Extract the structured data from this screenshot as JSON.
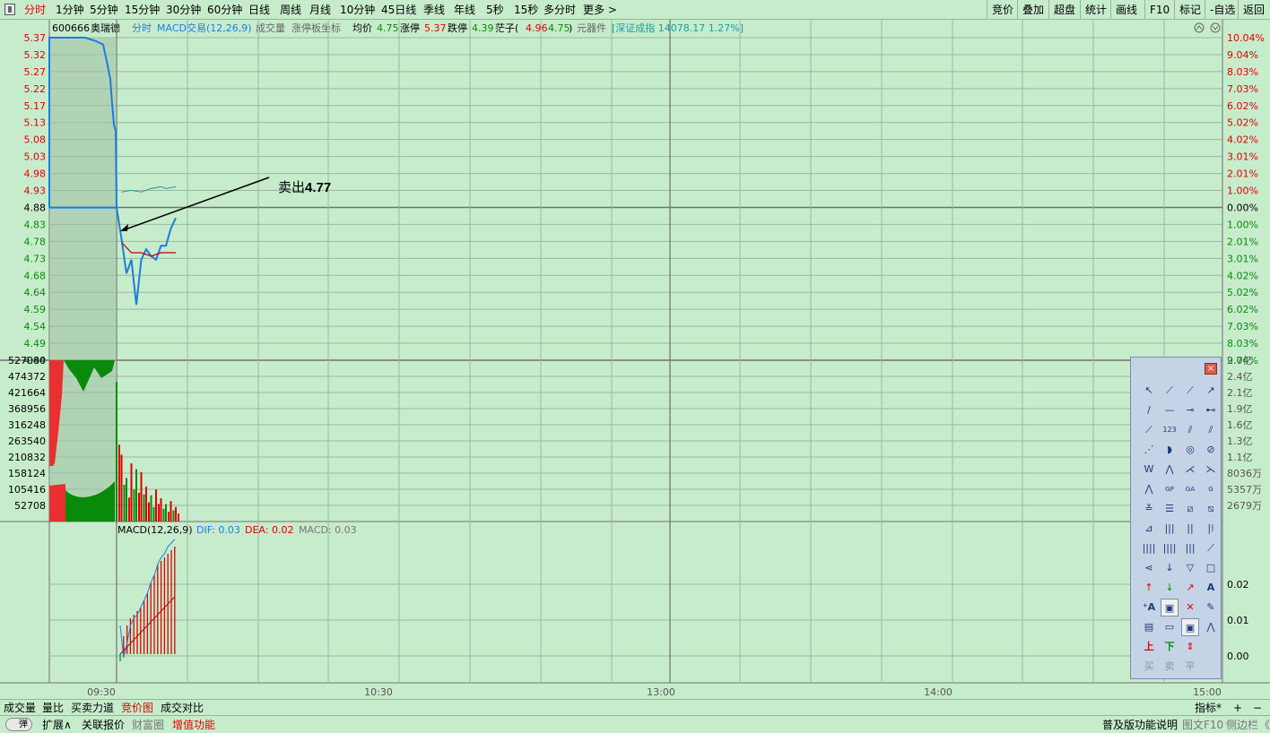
{
  "topbar": {
    "tabs": [
      "分时",
      "1分钟",
      "5分钟",
      "15分钟",
      "30分钟",
      "60分钟",
      "日线",
      "周线",
      "月线",
      "10分钟",
      "45日线",
      "季线",
      "年线",
      "5秒",
      "15秒",
      "多分时",
      "更多 >"
    ],
    "right": [
      "竞价",
      "叠加",
      "超盘",
      "统计",
      "画线",
      "F10",
      "标记",
      "-自选",
      "返回"
    ]
  },
  "header": {
    "code": "600666",
    "name": "奥瑞德",
    "mode": "分时",
    "indicator": "MACD交易(12,26,9)",
    "vol_label": "成交量",
    "limit_label": "涨停板坐标",
    "avg_label": "均价",
    "avg_value": "4.75",
    "up_label": "涨停",
    "up_value": "5.37",
    "down_label": "跌停",
    "down_value": "4.39",
    "bid_label": "茫子(",
    "bid_value1": "4.96",
    "bid_value2": "4.75",
    "bid_close": ")",
    "sector": "元器件",
    "index_text": "[深证成指 14078.17 1.27%]"
  },
  "price_axis": {
    "left": [
      "5.37",
      "5.32",
      "5.27",
      "5.22",
      "5.17",
      "5.13",
      "5.08",
      "5.03",
      "4.98",
      "4.93",
      "4.88",
      "4.83",
      "4.78",
      "4.73",
      "4.68",
      "4.64",
      "4.59",
      "4.54",
      "4.49",
      "4.44"
    ],
    "right": [
      "10.04%",
      "9.04%",
      "8.03%",
      "7.03%",
      "6.02%",
      "5.02%",
      "4.02%",
      "3.01%",
      "2.01%",
      "1.00%",
      "0.00%",
      "1.00%",
      "2.01%",
      "3.01%",
      "4.02%",
      "5.02%",
      "6.02%",
      "7.03%",
      "8.03%",
      "9.04%"
    ]
  },
  "volume_axis": {
    "left": [
      "527080",
      "474372",
      "421664",
      "368956",
      "316248",
      "263540",
      "210832",
      "158124",
      "105416",
      "52708"
    ],
    "right": [
      "2.7亿",
      "2.4亿",
      "2.1亿",
      "1.9亿",
      "1.6亿",
      "1.3亿",
      "1.1亿",
      "8036万",
      "5357万",
      "2679万"
    ]
  },
  "macd": {
    "title": "MACD(12,26,9)",
    "dif_label": "DIF: 0.03",
    "dea_label": "DEA: 0.02",
    "macd_label": "MACD: 0.03",
    "right": [
      "0.02",
      "0.01",
      "0.00"
    ]
  },
  "time_axis": [
    "09:30",
    "10:30",
    "13:00",
    "14:00",
    "15:00"
  ],
  "annotation": {
    "text": "卖出",
    "price": "4.77"
  },
  "bottombar": {
    "tabs": [
      "成交量",
      "量比",
      "买卖力道",
      "竞价图",
      "成交对比"
    ],
    "active": "竞价图",
    "right_label": "指标*",
    "plus": "+",
    "minus": "−"
  },
  "bottombar2": {
    "toggle": "弹",
    "items": [
      "扩展∧",
      "关联报价",
      "财富圈",
      "增值功能"
    ],
    "right": [
      "普及版功能说明",
      "图文F10",
      "侧边栏",
      "《"
    ]
  },
  "toolbox": {
    "close": "×",
    "bottom": [
      "买",
      "卖",
      "平"
    ]
  },
  "colors": {
    "bg": "#c7eccc",
    "up": "#e00000",
    "down": "#0a8a0a",
    "price_line": "#1c7de0",
    "avg_line": "#c00000"
  },
  "chart_data": {
    "type": "line",
    "title": "600666 奥瑞德 分时",
    "price_ylim": [
      4.44,
      5.37
    ],
    "prev_close": 4.88,
    "price_series": [
      {
        "t": "09:30",
        "v": 4.88
      },
      {
        "t": "09:31",
        "v": 4.79
      },
      {
        "t": "09:32",
        "v": 4.69
      },
      {
        "t": "09:33",
        "v": 4.73
      },
      {
        "t": "09:34",
        "v": 4.6
      },
      {
        "t": "09:35",
        "v": 4.73
      },
      {
        "t": "09:36",
        "v": 4.76
      },
      {
        "t": "09:37",
        "v": 4.74
      },
      {
        "t": "09:38",
        "v": 4.73
      },
      {
        "t": "09:39",
        "v": 4.77
      },
      {
        "t": "09:40",
        "v": 4.77
      },
      {
        "t": "09:41",
        "v": 4.82
      },
      {
        "t": "09:42",
        "v": 4.85
      }
    ],
    "avg_series": [
      {
        "t": "09:31",
        "v": 4.78
      },
      {
        "t": "09:33",
        "v": 4.75
      },
      {
        "t": "09:35",
        "v": 4.75
      },
      {
        "t": "09:37",
        "v": 4.74
      },
      {
        "t": "09:39",
        "v": 4.75
      },
      {
        "t": "09:42",
        "v": 4.75
      }
    ],
    "volume": [
      {
        "t": "09:30",
        "v": 480000,
        "dir": "down"
      },
      {
        "t": "09:31",
        "v": 230000,
        "dir": "up"
      },
      {
        "t": "09:32",
        "v": 150000,
        "dir": "down"
      },
      {
        "t": "09:33",
        "v": 200000,
        "dir": "up"
      },
      {
        "t": "09:34",
        "v": 180000,
        "dir": "down"
      },
      {
        "t": "09:35",
        "v": 170000,
        "dir": "up"
      },
      {
        "t": "09:36",
        "v": 120000,
        "dir": "up"
      },
      {
        "t": "09:37",
        "v": 90000,
        "dir": "down"
      },
      {
        "t": "09:38",
        "v": 110000,
        "dir": "up"
      },
      {
        "t": "09:39",
        "v": 80000,
        "dir": "up"
      },
      {
        "t": "09:40",
        "v": 60000,
        "dir": "down"
      },
      {
        "t": "09:41",
        "v": 70000,
        "dir": "up"
      },
      {
        "t": "09:42",
        "v": 50000,
        "dir": "up"
      }
    ],
    "macd_ylim": [
      -0.008,
      0.032
    ],
    "macd_hist": [
      -0.002,
      0.005,
      0.008,
      0.01,
      0.011,
      0.012,
      0.013,
      0.015,
      0.017,
      0.02,
      0.022,
      0.025,
      0.026,
      0.027,
      0.028,
      0.029,
      0.03
    ],
    "dif": [
      0.008,
      -0.001,
      0.003,
      0.008,
      0.01,
      0.011,
      0.013,
      0.015,
      0.017,
      0.02,
      0.022,
      0.025,
      0.027,
      0.028,
      0.03,
      0.031,
      0.032
    ],
    "dea": [
      0.0,
      0.001,
      0.002,
      0.003,
      0.004,
      0.005,
      0.006,
      0.007,
      0.008,
      0.009,
      0.01,
      0.011,
      0.012,
      0.013,
      0.014,
      0.015,
      0.016
    ]
  }
}
